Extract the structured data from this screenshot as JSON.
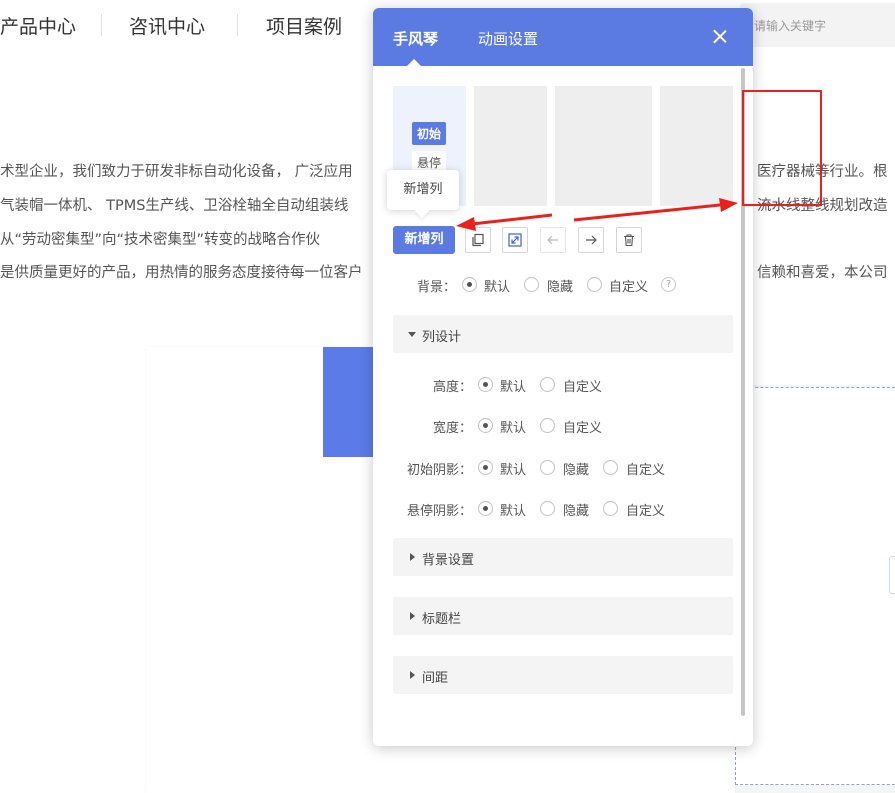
{
  "site": {
    "nav": [
      "产品中心",
      "咨讯中心",
      "项目案例"
    ],
    "search_placeholder": "请输入关键字",
    "paragraph_lines": [
      "术型企业，我们致力于研发非标自动化设备， 广泛应用",
      "气装帽一体机、 TPMS生产线、卫浴栓轴全自动组装线",
      "从“劳动密集型”向“技术密集型”转变的战略合作伙",
      "是供质量更好的产品，用热情的服务态度接待每一位客户"
    ],
    "paragraph_right": [
      "医疗器械等行业。根",
      "流水线整线规划改造",
      "信赖和喜爱，本公司"
    ]
  },
  "panel": {
    "tabs": [
      "手风琴",
      "动画设置"
    ],
    "states": {
      "initial": "初始",
      "hover": "悬停"
    },
    "tooltip": "新增列",
    "add_column_label": "新增列",
    "icons": [
      "copy-icon",
      "resize-icon",
      "arrow-left-icon",
      "arrow-right-icon",
      "trash-icon"
    ],
    "background": {
      "label": "背景：",
      "options": [
        "默认",
        "隐藏",
        "自定义"
      ],
      "help": "?"
    },
    "column_design": {
      "title": "列设计",
      "rows": [
        {
          "label": "高度：",
          "options": [
            "默认",
            "自定义"
          ]
        },
        {
          "label": "宽度：",
          "options": [
            "默认",
            "自定义"
          ]
        },
        {
          "label": "初始阴影：",
          "options": [
            "默认",
            "隐藏",
            "自定义"
          ]
        },
        {
          "label": "悬停阴影：",
          "options": [
            "默认",
            "隐藏",
            "自定义"
          ]
        }
      ]
    },
    "sections": [
      "背景设置",
      "标题栏",
      "间距"
    ]
  },
  "colors": {
    "accent": "#5b7be2",
    "annotation": "#e8211d"
  }
}
